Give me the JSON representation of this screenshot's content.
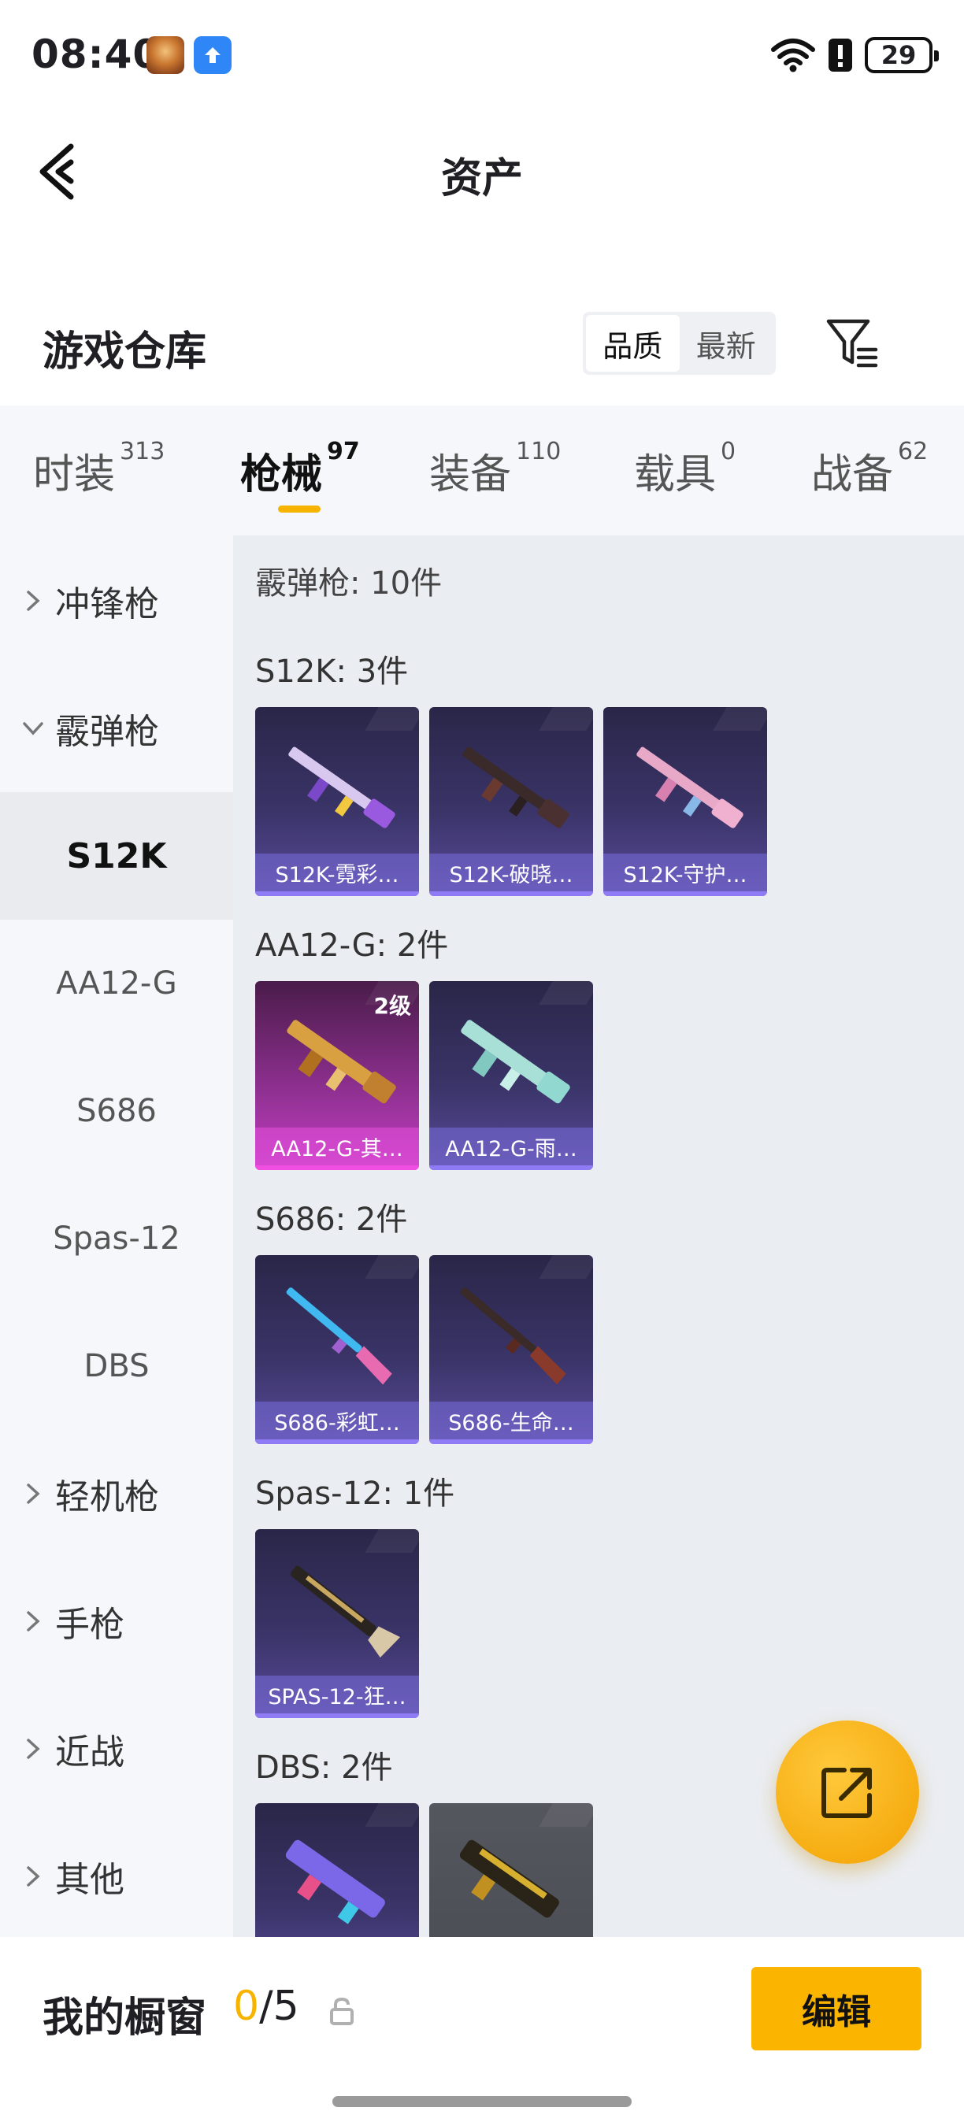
{
  "status_bar": {
    "time": "08:40",
    "battery": "29"
  },
  "header": {
    "title": "资产"
  },
  "warehouse": {
    "title": "游戏仓库",
    "sort_options": [
      "品质",
      "最新"
    ],
    "sort_selected": "品质"
  },
  "tabs": [
    {
      "label": "时装",
      "count": "313"
    },
    {
      "label": "枪械",
      "count": "97",
      "active": true
    },
    {
      "label": "装备",
      "count": "110"
    },
    {
      "label": "载具",
      "count": "0"
    },
    {
      "label": "战备",
      "count": "62"
    }
  ],
  "side_nav": [
    {
      "label": "冲锋枪",
      "type": "category",
      "expanded": false
    },
    {
      "label": "霰弹枪",
      "type": "category",
      "expanded": true
    },
    {
      "label": "S12K",
      "type": "sub",
      "selected": true
    },
    {
      "label": "AA12-G",
      "type": "sub"
    },
    {
      "label": "S686",
      "type": "sub"
    },
    {
      "label": "Spas-12",
      "type": "sub"
    },
    {
      "label": "DBS",
      "type": "sub"
    },
    {
      "label": "轻机枪",
      "type": "category",
      "expanded": false
    },
    {
      "label": "手枪",
      "type": "category",
      "expanded": false
    },
    {
      "label": "近战",
      "type": "category",
      "expanded": false
    },
    {
      "label": "其他",
      "type": "category",
      "expanded": false
    }
  ],
  "content": {
    "summary": "霰弹枪: 10件",
    "groups": [
      {
        "title": "S12K: 3件",
        "items": [
          {
            "name": "S12K-霓彩…",
            "rarity": "purple"
          },
          {
            "name": "S12K-破晓…",
            "rarity": "purple"
          },
          {
            "name": "S12K-守护…",
            "rarity": "purple"
          }
        ]
      },
      {
        "title": "AA12-G: 2件",
        "items": [
          {
            "name": "AA12-G-其…",
            "rarity": "pink",
            "level": "2级"
          },
          {
            "name": "AA12-G-雨…",
            "rarity": "purple"
          }
        ]
      },
      {
        "title": "S686: 2件",
        "items": [
          {
            "name": "S686-彩虹…",
            "rarity": "purple"
          },
          {
            "name": "S686-生命…",
            "rarity": "purple"
          }
        ]
      },
      {
        "title": "Spas-12: 1件",
        "items": [
          {
            "name": "SPAS-12-狂…",
            "rarity": "purple"
          }
        ]
      },
      {
        "title": "DBS: 2件",
        "items": [
          {
            "name": "",
            "rarity": "purple"
          },
          {
            "name": "",
            "rarity": "grey"
          }
        ]
      }
    ]
  },
  "showcase": {
    "title": "我的橱窗",
    "current": "0",
    "separator_total": "/5",
    "edit_label": "编辑"
  },
  "icons": {
    "back": "chevron-left-icon",
    "filter": "filter-icon",
    "share": "share-external-icon",
    "lock": "lock-icon",
    "wifi": "wifi-icon",
    "alert": "alert-icon"
  },
  "colors": {
    "accent": "#f6b400",
    "edit_button": "#fbb400"
  }
}
